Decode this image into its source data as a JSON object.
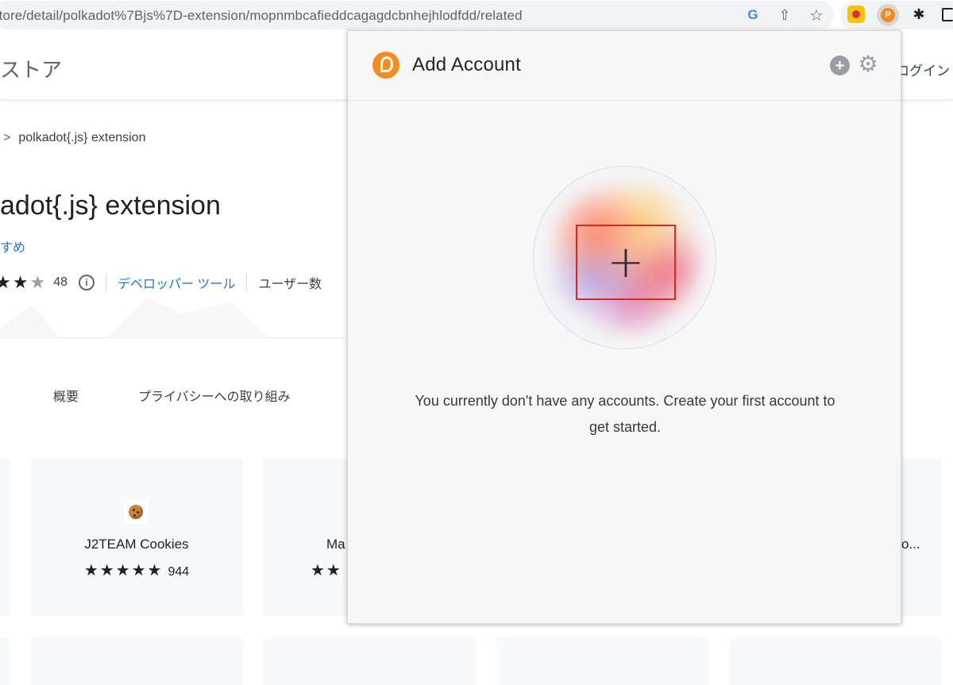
{
  "browser": {
    "url": "store/detail/polkadot%7Bjs%7D-extension/mopnmbcafieddcagagdcbnhejhlodfdd/related"
  },
  "store": {
    "title": "ストア",
    "login": "ログイン",
    "breadcrumb_chevron": ">",
    "breadcrumb": "polkadot{.js} extension",
    "extension_title": "adot{.js} extension",
    "recommended": "すめ",
    "rating_count": "48",
    "category": "デベロッパー ツール",
    "users_label": "ユーザー数",
    "tabs": [
      "概要",
      "プライバシーへの取り組み"
    ],
    "cards": [
      {
        "name": "J2TEAM Cookies",
        "stars": "★★★★★",
        "count": "944"
      },
      {
        "name": "Ma",
        "stars": "★★"
      },
      {
        "name": "o..."
      }
    ]
  },
  "popup": {
    "title": "Add Account",
    "empty_message": "You currently don't have any accounts. Create your first account to get started.",
    "add_glyph": "+"
  },
  "colors": {
    "accent": "#f68b1f",
    "highlight": "#e0271a",
    "link": "#1a73e8"
  }
}
